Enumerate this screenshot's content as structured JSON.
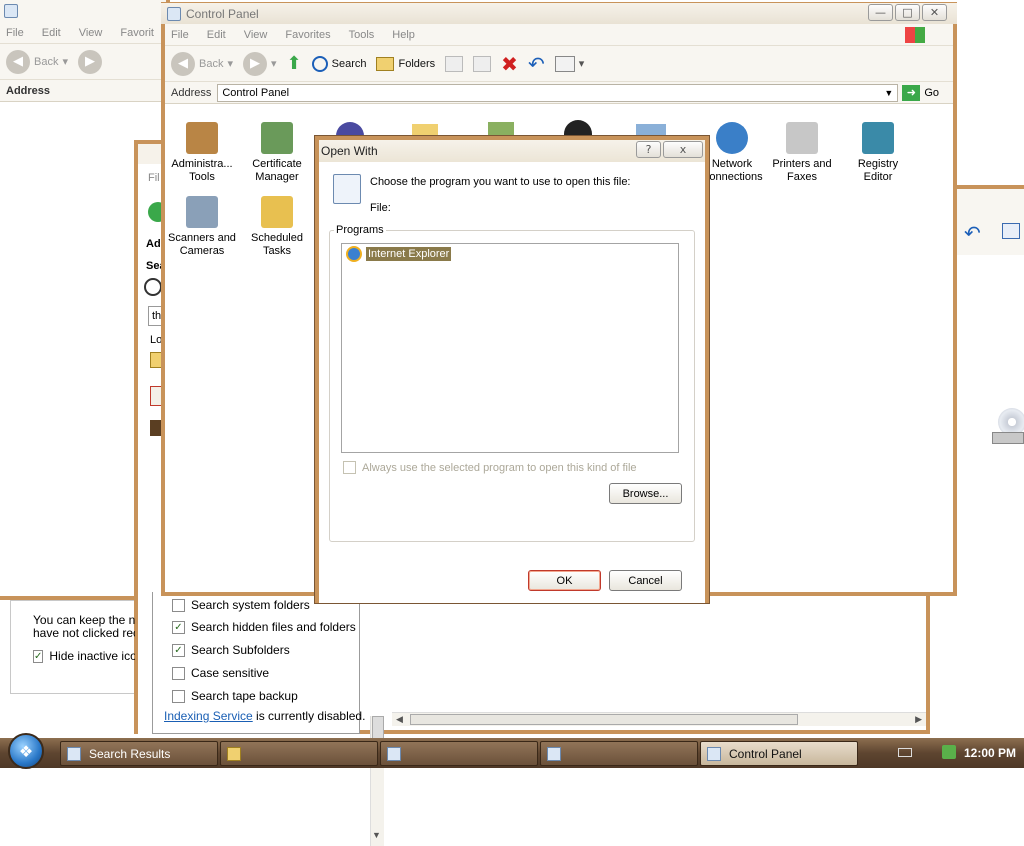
{
  "back_window": {
    "menu": [
      "File",
      "Edit",
      "View",
      "Favorit"
    ],
    "back_label": "Back",
    "address_label": "Address"
  },
  "control_panel": {
    "title": "Control Panel",
    "menu": [
      "File",
      "Edit",
      "View",
      "Favorites",
      "Tools",
      "Help"
    ],
    "toolbar": {
      "back": "Back",
      "search": "Search",
      "folders": "Folders"
    },
    "address_label": "Address",
    "address_value": "Control Panel",
    "go_label": "Go",
    "icons": [
      {
        "label_1": "Administra...",
        "label_2": "Tools",
        "color": "#b98545"
      },
      {
        "label_1": "Certificate",
        "label_2": "Manager",
        "color": "#6a9a5a"
      },
      {
        "label_1": "Scanners and",
        "label_2": "Cameras",
        "color": "#8aa0b8"
      },
      {
        "label_1": "Scheduled",
        "label_2": "Tasks",
        "color": "#e8c050"
      },
      {
        "label_1": "Network",
        "label_2": "Connections",
        "color": "#3a7fc8"
      },
      {
        "label_1": "Printers and",
        "label_2": "Faxes",
        "color": "#c7c7c7"
      },
      {
        "label_1": "Registry",
        "label_2": "Editor",
        "color": "#3a8aa8"
      }
    ]
  },
  "search_window": {
    "partial_labels": {
      "file": "Fil",
      "address": "Add",
      "search": "Sea",
      "look": "Lo",
      "text": "th"
    },
    "options": [
      {
        "label": "Search system folders",
        "checked": false
      },
      {
        "label": "Search hidden files and folders",
        "checked": true
      },
      {
        "label": "Search Subfolders",
        "checked": true
      },
      {
        "label": "Case sensitive",
        "checked": false
      },
      {
        "label": "Search tape backup",
        "checked": false
      }
    ],
    "indexing_link": "Indexing Service",
    "indexing_suffix": " is currently disabled."
  },
  "taskbar_props": {
    "text_line1": "You can keep the no",
    "text_line2": "have not clicked rece",
    "hide_label": "Hide inactive icon"
  },
  "open_with": {
    "title": "Open With",
    "help_btn": "?",
    "close_btn": "x",
    "instruction": "Choose the program you want to use to open this file:",
    "file_label": "File:",
    "programs_label": "Programs",
    "programs": [
      "Internet Explorer"
    ],
    "always_use": "Always use the selected program to open this kind of file",
    "browse": "Browse...",
    "ok": "OK",
    "cancel": "Cancel"
  },
  "taskbar": {
    "buttons": [
      "Search Results",
      "",
      "",
      "",
      "Control Panel"
    ],
    "clock": "12:00 PM"
  },
  "colors": {
    "accent": "#c8935a",
    "selection": "#8a7a4a"
  }
}
